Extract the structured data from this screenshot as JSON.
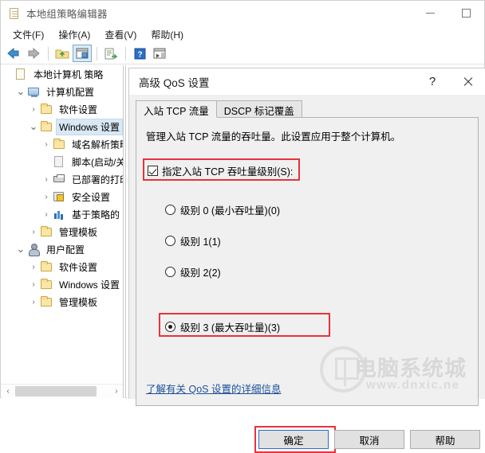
{
  "window": {
    "title": "本地组策略编辑器",
    "icon": "policy-document-icon",
    "minimize_label": "—",
    "maximize_label": "□"
  },
  "menu": {
    "items": [
      {
        "label": "文件(F)",
        "name": "menu-file"
      },
      {
        "label": "操作(A)",
        "name": "menu-action"
      },
      {
        "label": "查看(V)",
        "name": "menu-view"
      },
      {
        "label": "帮助(H)",
        "name": "menu-help"
      }
    ]
  },
  "toolbar": {
    "buttons": [
      {
        "name": "back-arrow-icon",
        "glyph": "←"
      },
      {
        "name": "forward-arrow-icon",
        "glyph": "→"
      },
      {
        "name": "up-folder-icon",
        "glyph": "↑"
      },
      {
        "name": "show-hide-tree-icon",
        "glyph": "▤"
      },
      {
        "name": "export-list-icon",
        "glyph": "❐"
      },
      {
        "name": "help-icon",
        "glyph": "?"
      },
      {
        "name": "show-details-icon",
        "glyph": "▥"
      }
    ]
  },
  "tree": {
    "items": [
      {
        "label": "本地计算机 策略",
        "indent": 0,
        "twisty": "",
        "icon": "policy-document-icon",
        "selected": false
      },
      {
        "label": "计算机配置",
        "indent": 1,
        "twisty": "v",
        "icon": "computer-icon",
        "selected": false
      },
      {
        "label": "软件设置",
        "indent": 2,
        "twisty": ">",
        "icon": "folder-icon",
        "selected": false
      },
      {
        "label": "Windows 设置",
        "indent": 2,
        "twisty": "v",
        "icon": "folder-icon",
        "selected": true
      },
      {
        "label": "域名解析策略",
        "indent": 3,
        "twisty": ">",
        "icon": "folder-icon",
        "selected": false
      },
      {
        "label": "脚本(启动/关",
        "indent": 3,
        "twisty": "",
        "icon": "script-icon",
        "selected": false
      },
      {
        "label": "已部署的打印",
        "indent": 3,
        "twisty": ">",
        "icon": "printer-icon",
        "selected": false
      },
      {
        "label": "安全设置",
        "indent": 3,
        "twisty": ">",
        "icon": "security-icon",
        "selected": false
      },
      {
        "label": "基于策略的 C",
        "indent": 3,
        "twisty": ">",
        "icon": "qos-chart-icon",
        "selected": false
      },
      {
        "label": "管理模板",
        "indent": 2,
        "twisty": ">",
        "icon": "folder-icon",
        "selected": false
      },
      {
        "label": "用户配置",
        "indent": 1,
        "twisty": "v",
        "icon": "user-icon",
        "selected": false
      },
      {
        "label": "软件设置",
        "indent": 2,
        "twisty": ">",
        "icon": "folder-icon",
        "selected": false
      },
      {
        "label": "Windows 设置",
        "indent": 2,
        "twisty": ">",
        "icon": "folder-icon",
        "selected": false
      },
      {
        "label": "管理模板",
        "indent": 2,
        "twisty": ">",
        "icon": "folder-icon",
        "selected": false
      }
    ],
    "scroll_left_glyph": "‹",
    "scroll_right_glyph": "›"
  },
  "dialog": {
    "title": "高级 QoS 设置",
    "help_button": "?",
    "close_button": "close-icon",
    "tabs": [
      {
        "label": "入站 TCP 流量",
        "active": true
      },
      {
        "label": "DSCP 标记覆盖",
        "active": false
      }
    ],
    "description": "管理入站 TCP 流量的吞吐量。此设置应用于整个计算机。",
    "checkbox": {
      "label": "指定入站 TCP 吞吐量级别(S):",
      "checked": true,
      "highlighted": true
    },
    "radios": [
      {
        "label": "级别 0 (最小吞吐量)(0)",
        "selected": false,
        "highlighted": false
      },
      {
        "label": "级别 1(1)",
        "selected": false,
        "highlighted": false
      },
      {
        "label": "级别 2(2)",
        "selected": false,
        "highlighted": false
      },
      {
        "label": "级别 3 (最大吞吐量)(3)",
        "selected": true,
        "highlighted": true
      }
    ],
    "help_link": "了解有关 QoS 设置的详细信息",
    "buttons": {
      "ok": "确定",
      "cancel": "取消",
      "help": "帮助"
    }
  },
  "watermark": {
    "text": "电脑系统城",
    "sub": "www.dnxic.ne"
  },
  "colors": {
    "highlight_red": "#e8323c",
    "selection_blue": "#d9e8f5",
    "link_blue": "#1b4f9c",
    "default_button_border": "#2a6fc4"
  }
}
